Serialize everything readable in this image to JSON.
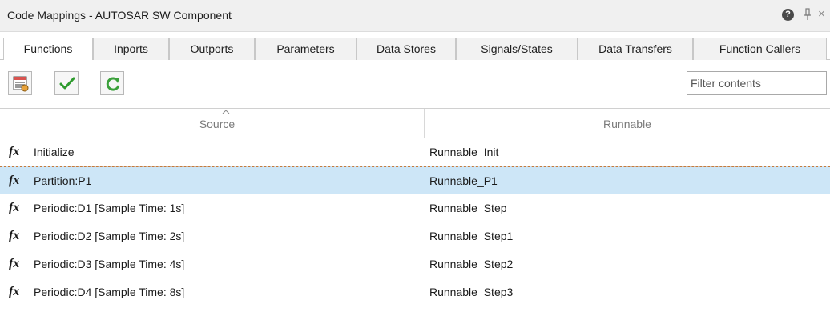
{
  "window": {
    "title": "Code Mappings - AUTOSAR SW Component",
    "help_icon": "question-circle-icon",
    "pin_icon": "pin-icon",
    "close_label": "×"
  },
  "tabs": [
    {
      "label": "Functions",
      "active": true
    },
    {
      "label": "Inports",
      "active": false
    },
    {
      "label": "Outports",
      "active": false
    },
    {
      "label": "Parameters",
      "active": false
    },
    {
      "label": "Data Stores",
      "active": false
    },
    {
      "label": "Signals/States",
      "active": false
    },
    {
      "label": "Data Transfers",
      "active": false
    },
    {
      "label": "Function Callers",
      "active": false
    }
  ],
  "toolbar": {
    "buttons": [
      "configure-table-icon",
      "validate-checkmark-icon",
      "refresh-icon"
    ],
    "filter_placeholder": "Filter contents"
  },
  "table": {
    "columns": [
      "Source",
      "Runnable"
    ],
    "sort_column": "Source",
    "rows": [
      {
        "icon": "fx",
        "source": "Initialize",
        "runnable": "Runnable_Init",
        "selected": false
      },
      {
        "icon": "fx",
        "source": "Partition:P1",
        "runnable": "Runnable_P1",
        "selected": true
      },
      {
        "icon": "fx",
        "source": "Periodic:D1 [Sample Time: 1s]",
        "runnable": "Runnable_Step",
        "selected": false
      },
      {
        "icon": "fx",
        "source": "Periodic:D2 [Sample Time: 2s]",
        "runnable": "Runnable_Step1",
        "selected": false
      },
      {
        "icon": "fx",
        "source": "Periodic:D3 [Sample Time: 4s]",
        "runnable": "Runnable_Step2",
        "selected": false
      },
      {
        "icon": "fx",
        "source": "Periodic:D4 [Sample Time: 8s]",
        "runnable": "Runnable_Step3",
        "selected": false
      }
    ]
  },
  "colors": {
    "selection": "#cde6f7",
    "selection_border": "#c77a3a",
    "check_green": "#2e9b2e"
  }
}
